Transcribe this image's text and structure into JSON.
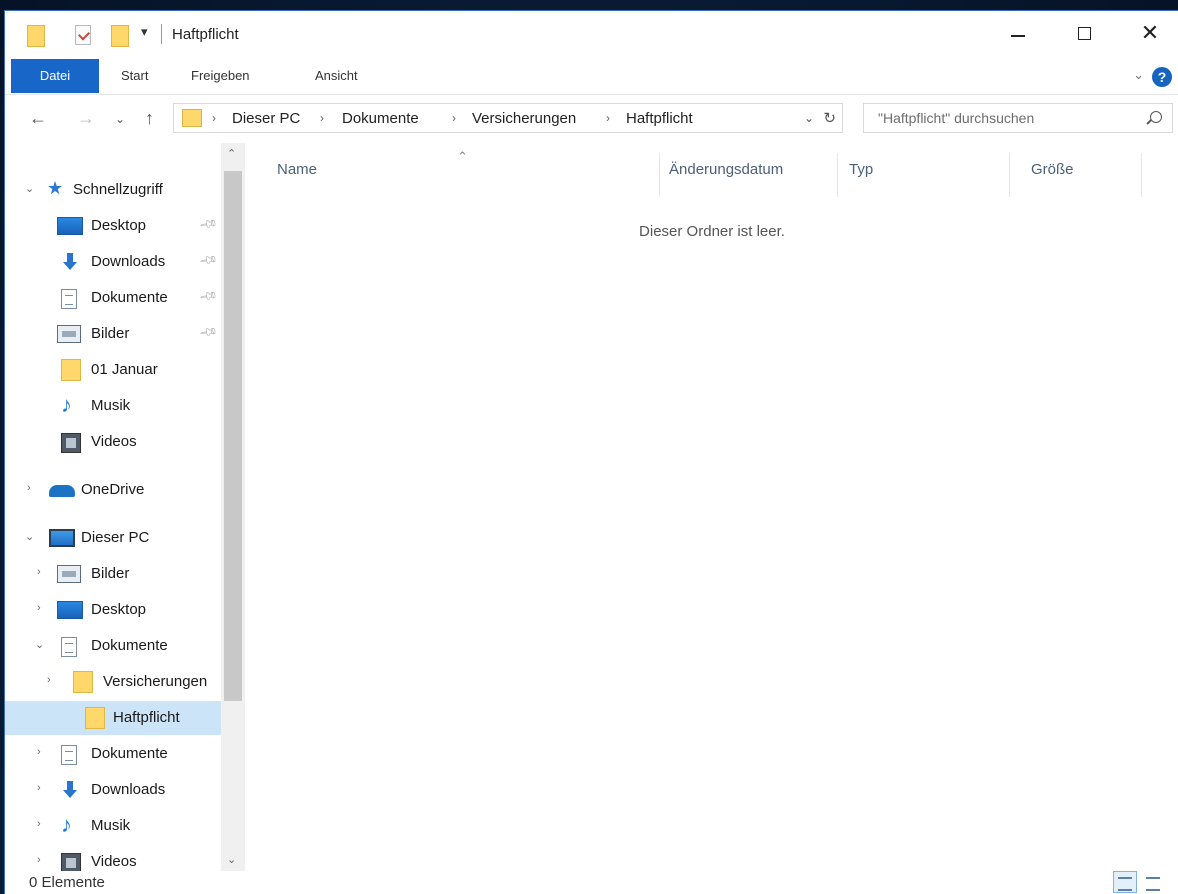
{
  "window": {
    "title": "Haftpflicht",
    "quick_access_dropdown": "▾"
  },
  "ribbon": {
    "tabs": [
      "Datei",
      "Start",
      "Freigeben",
      "Ansicht"
    ],
    "help_label": "?"
  },
  "address": {
    "breadcrumbs": [
      "Dieser PC",
      "Dokumente",
      "Versicherungen",
      "Haftpflicht"
    ]
  },
  "search": {
    "placeholder": "\"Haftpflicht\" durchsuchen"
  },
  "navigation": {
    "quick_access": {
      "label": "Schnellzugriff",
      "items": [
        {
          "label": "Desktop",
          "icon": "desktop-icon",
          "pinned": true
        },
        {
          "label": "Downloads",
          "icon": "downloads-icon",
          "pinned": true
        },
        {
          "label": "Dokumente",
          "icon": "documents-icon",
          "pinned": true
        },
        {
          "label": "Bilder",
          "icon": "pictures-icon",
          "pinned": true
        },
        {
          "label": "01 Januar",
          "icon": "folder-icon",
          "pinned": false
        },
        {
          "label": "Musik",
          "icon": "music-icon",
          "pinned": false
        },
        {
          "label": "Videos",
          "icon": "videos-icon",
          "pinned": false
        }
      ]
    },
    "onedrive": {
      "label": "OneDrive"
    },
    "this_pc": {
      "label": "Dieser PC",
      "items": [
        {
          "label": "Bilder"
        },
        {
          "label": "Desktop"
        },
        {
          "label": "Dokumente"
        },
        {
          "label": "Versicherungen"
        },
        {
          "label": "Haftpflicht",
          "selected": true
        },
        {
          "label": "Dokumente"
        },
        {
          "label": "Downloads"
        },
        {
          "label": "Musik"
        },
        {
          "label": "Videos"
        }
      ]
    }
  },
  "columns": [
    "Name",
    "Änderungsdatum",
    "Typ",
    "Größe"
  ],
  "content": {
    "empty_message": "Dieser Ordner ist leer."
  },
  "status": {
    "item_count": "0 Elemente"
  },
  "colors": {
    "accent": "#1966c9",
    "selection": "#cce4f7",
    "folder": "#ffd86b"
  }
}
